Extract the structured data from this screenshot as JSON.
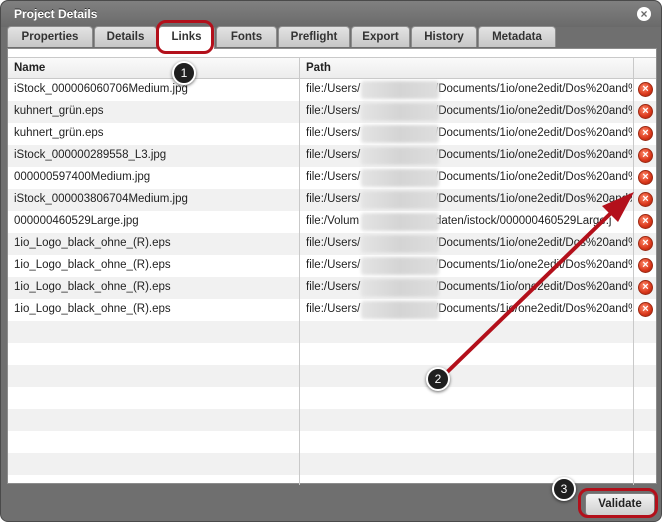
{
  "dialog": {
    "title": "Project Details",
    "close_glyph": "×"
  },
  "tabs": [
    {
      "label": "Properties",
      "active": false
    },
    {
      "label": "Details",
      "active": false
    },
    {
      "label": "Links",
      "active": true
    },
    {
      "label": "Fonts",
      "active": false
    },
    {
      "label": "Preflight",
      "active": false
    },
    {
      "label": "Export",
      "active": false
    },
    {
      "label": "History",
      "active": false
    },
    {
      "label": "Metadata",
      "active": false
    }
  ],
  "table": {
    "columns": {
      "name": "Name",
      "path": "Path"
    },
    "rows": [
      {
        "name": "iStock_000006060706Medium.jpg",
        "path_start": "file:/Users/",
        "path_end": "/Documents/1io/one2edit/Dos%20and%"
      },
      {
        "name": "kuhnert_grün.eps",
        "path_start": "file:/Users/",
        "path_end": "/Documents/1io/one2edit/Dos%20and%"
      },
      {
        "name": "kuhnert_grün.eps",
        "path_start": "file:/Users/",
        "path_end": "/Documents/1io/one2edit/Dos%20and%"
      },
      {
        "name": "iStock_000000289558_L3.jpg",
        "path_start": "file:/Users/",
        "path_end": "/Documents/1io/one2edit/Dos%20and%"
      },
      {
        "name": "000000597400Medium.jpg",
        "path_start": "file:/Users/",
        "path_end": "/Documents/1io/one2edit/Dos%20and%"
      },
      {
        "name": "iStock_000003806704Medium.jpg",
        "path_start": "file:/Users/",
        "path_end": "/Documents/1io/one2edit/Dos%20and%"
      },
      {
        "name": "000000460529Large.jpg",
        "path_start": "file:/Volum",
        "path_end": "daten/istock/000000460529Large.j"
      },
      {
        "name": "1io_Logo_black_ohne_(R).eps",
        "path_start": "file:/Users/",
        "path_end": "/Documents/1io/one2edit/Dos%20and%"
      },
      {
        "name": "1io_Logo_black_ohne_(R).eps",
        "path_start": "file:/Users/",
        "path_end": "/Documents/1io/one2edit/Dos%20and%"
      },
      {
        "name": "1io_Logo_black_ohne_(R).eps",
        "path_start": "file:/Users/",
        "path_end": "/Documents/1io/one2edit/Dos%20and%"
      },
      {
        "name": "1io_Logo_black_ohne_(R).eps",
        "path_start": "file:/Users/",
        "path_end": "/Documents/1io/one2edit/Dos%20and%"
      }
    ],
    "empty_rows": 7,
    "remove_glyph": "×"
  },
  "footer": {
    "validate_label": "Validate"
  },
  "annotations": {
    "badge_1": "1",
    "badge_2": "2",
    "badge_3": "3",
    "highlight_color": "#b3101b"
  }
}
